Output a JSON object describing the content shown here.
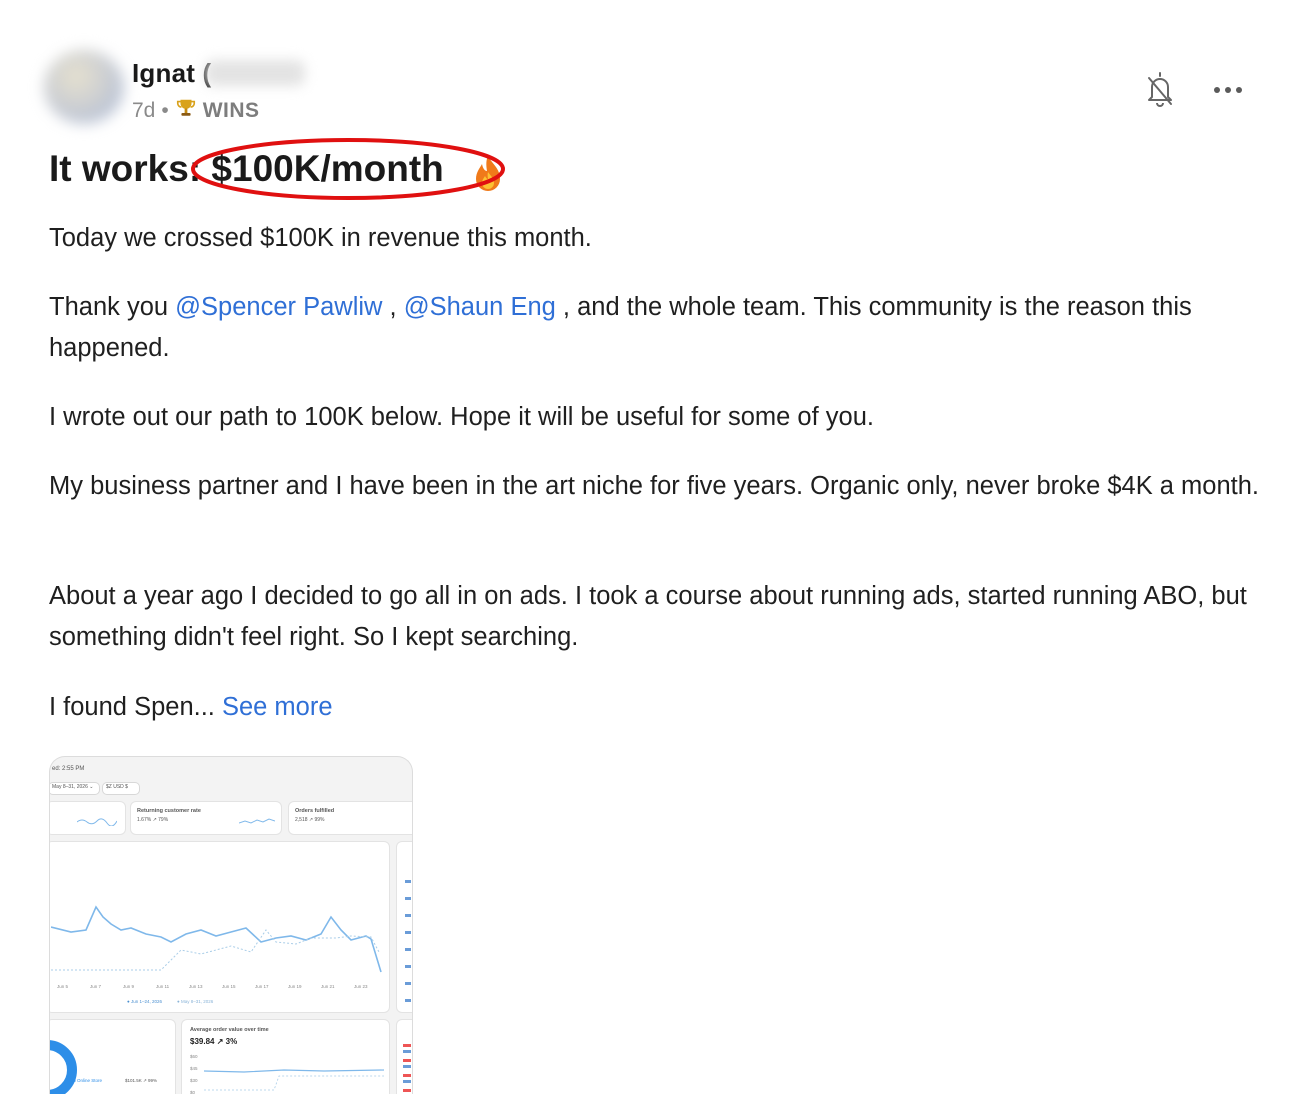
{
  "post": {
    "author": "Ignat (",
    "age": "7d",
    "separator": "•",
    "category_icon": "trophy-icon",
    "category": "WINS",
    "title_prefix": "It works: ",
    "title_highlight": "$100K/month",
    "title_emoji_icon": "fire-icon",
    "body": {
      "p1": "Today we crossed $100K in revenue this month.",
      "p2_start": "Thank you ",
      "mention1": "@Spencer Pawliw",
      "p2_mid": " , ",
      "mention2": "@Shaun Eng",
      "p2_end": " , and the whole team. This community is the reason this happened.",
      "p3": "I wrote out our path to 100K below. Hope it will be useful for some of you.",
      "p4": "My business partner and I have been in the art niche for five years. Organic only, never broke $4K a month.",
      "p5": "About a year ago I decided to go all in on ads. I took a course about running ads, started running ABO, but something didn't feel right. So I kept searching.",
      "p6": "I found Spen... ",
      "see_more": "See more"
    }
  },
  "thumbnail": {
    "updated": "ed: 2:55 PM",
    "date_range": "May 8–31, 2026 ⌄",
    "currency": "$Z USD $",
    "card1_title": "Returning customer rate",
    "card1_value": "1.67% ↗ 79%",
    "card2_title": "Orders fulfilled",
    "card2_value": "2,518 ↗ 99%",
    "x_ticks": [
      "Jun 5",
      "Jun 7",
      "Jun 9",
      "Jun 11",
      "Jun 13",
      "Jun 15",
      "Jun 17",
      "Jun 19",
      "Jun 21",
      "Jun 23"
    ],
    "legend1": "● Jun 1–24, 2026",
    "legend2": "● May 8–31, 2026",
    "aov_title": "Average order value over time",
    "aov_value": "$39.84 ↗ 3%",
    "aov_ticks": [
      "$60",
      "$45",
      "$30",
      "$0"
    ],
    "store_label": "■ Online Store",
    "store_value": "$101.5K ↗ 99%"
  },
  "colors": {
    "link": "#2f6fd6",
    "highlight_ring": "#e01010",
    "chart_line": "#7fb8ea"
  }
}
